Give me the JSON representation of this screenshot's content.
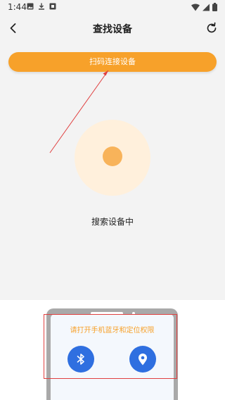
{
  "status_bar": {
    "time": "1:44",
    "icons_left": [
      "image-icon",
      "download-icon",
      "app-icon"
    ],
    "icons_right": [
      "wifi-icon",
      "signal-icon",
      "battery-icon"
    ]
  },
  "nav": {
    "title": "查找设备",
    "back_icon": "chevron-left-icon",
    "refresh_icon": "refresh-icon"
  },
  "scan_button": {
    "label": "扫码连接设备"
  },
  "search": {
    "status_text": "搜索设备中"
  },
  "permission": {
    "prompt": "请打开手机蓝牙和定位权限",
    "icons": [
      "bluetooth-icon",
      "location-icon"
    ]
  },
  "colors": {
    "accent": "#f7a12a",
    "page_bg": "#f3f3f3",
    "icon_blue": "#2f6fe0",
    "halo": "#fff0dc",
    "core": "#f8b35a",
    "annotation_red": "#e04040"
  }
}
